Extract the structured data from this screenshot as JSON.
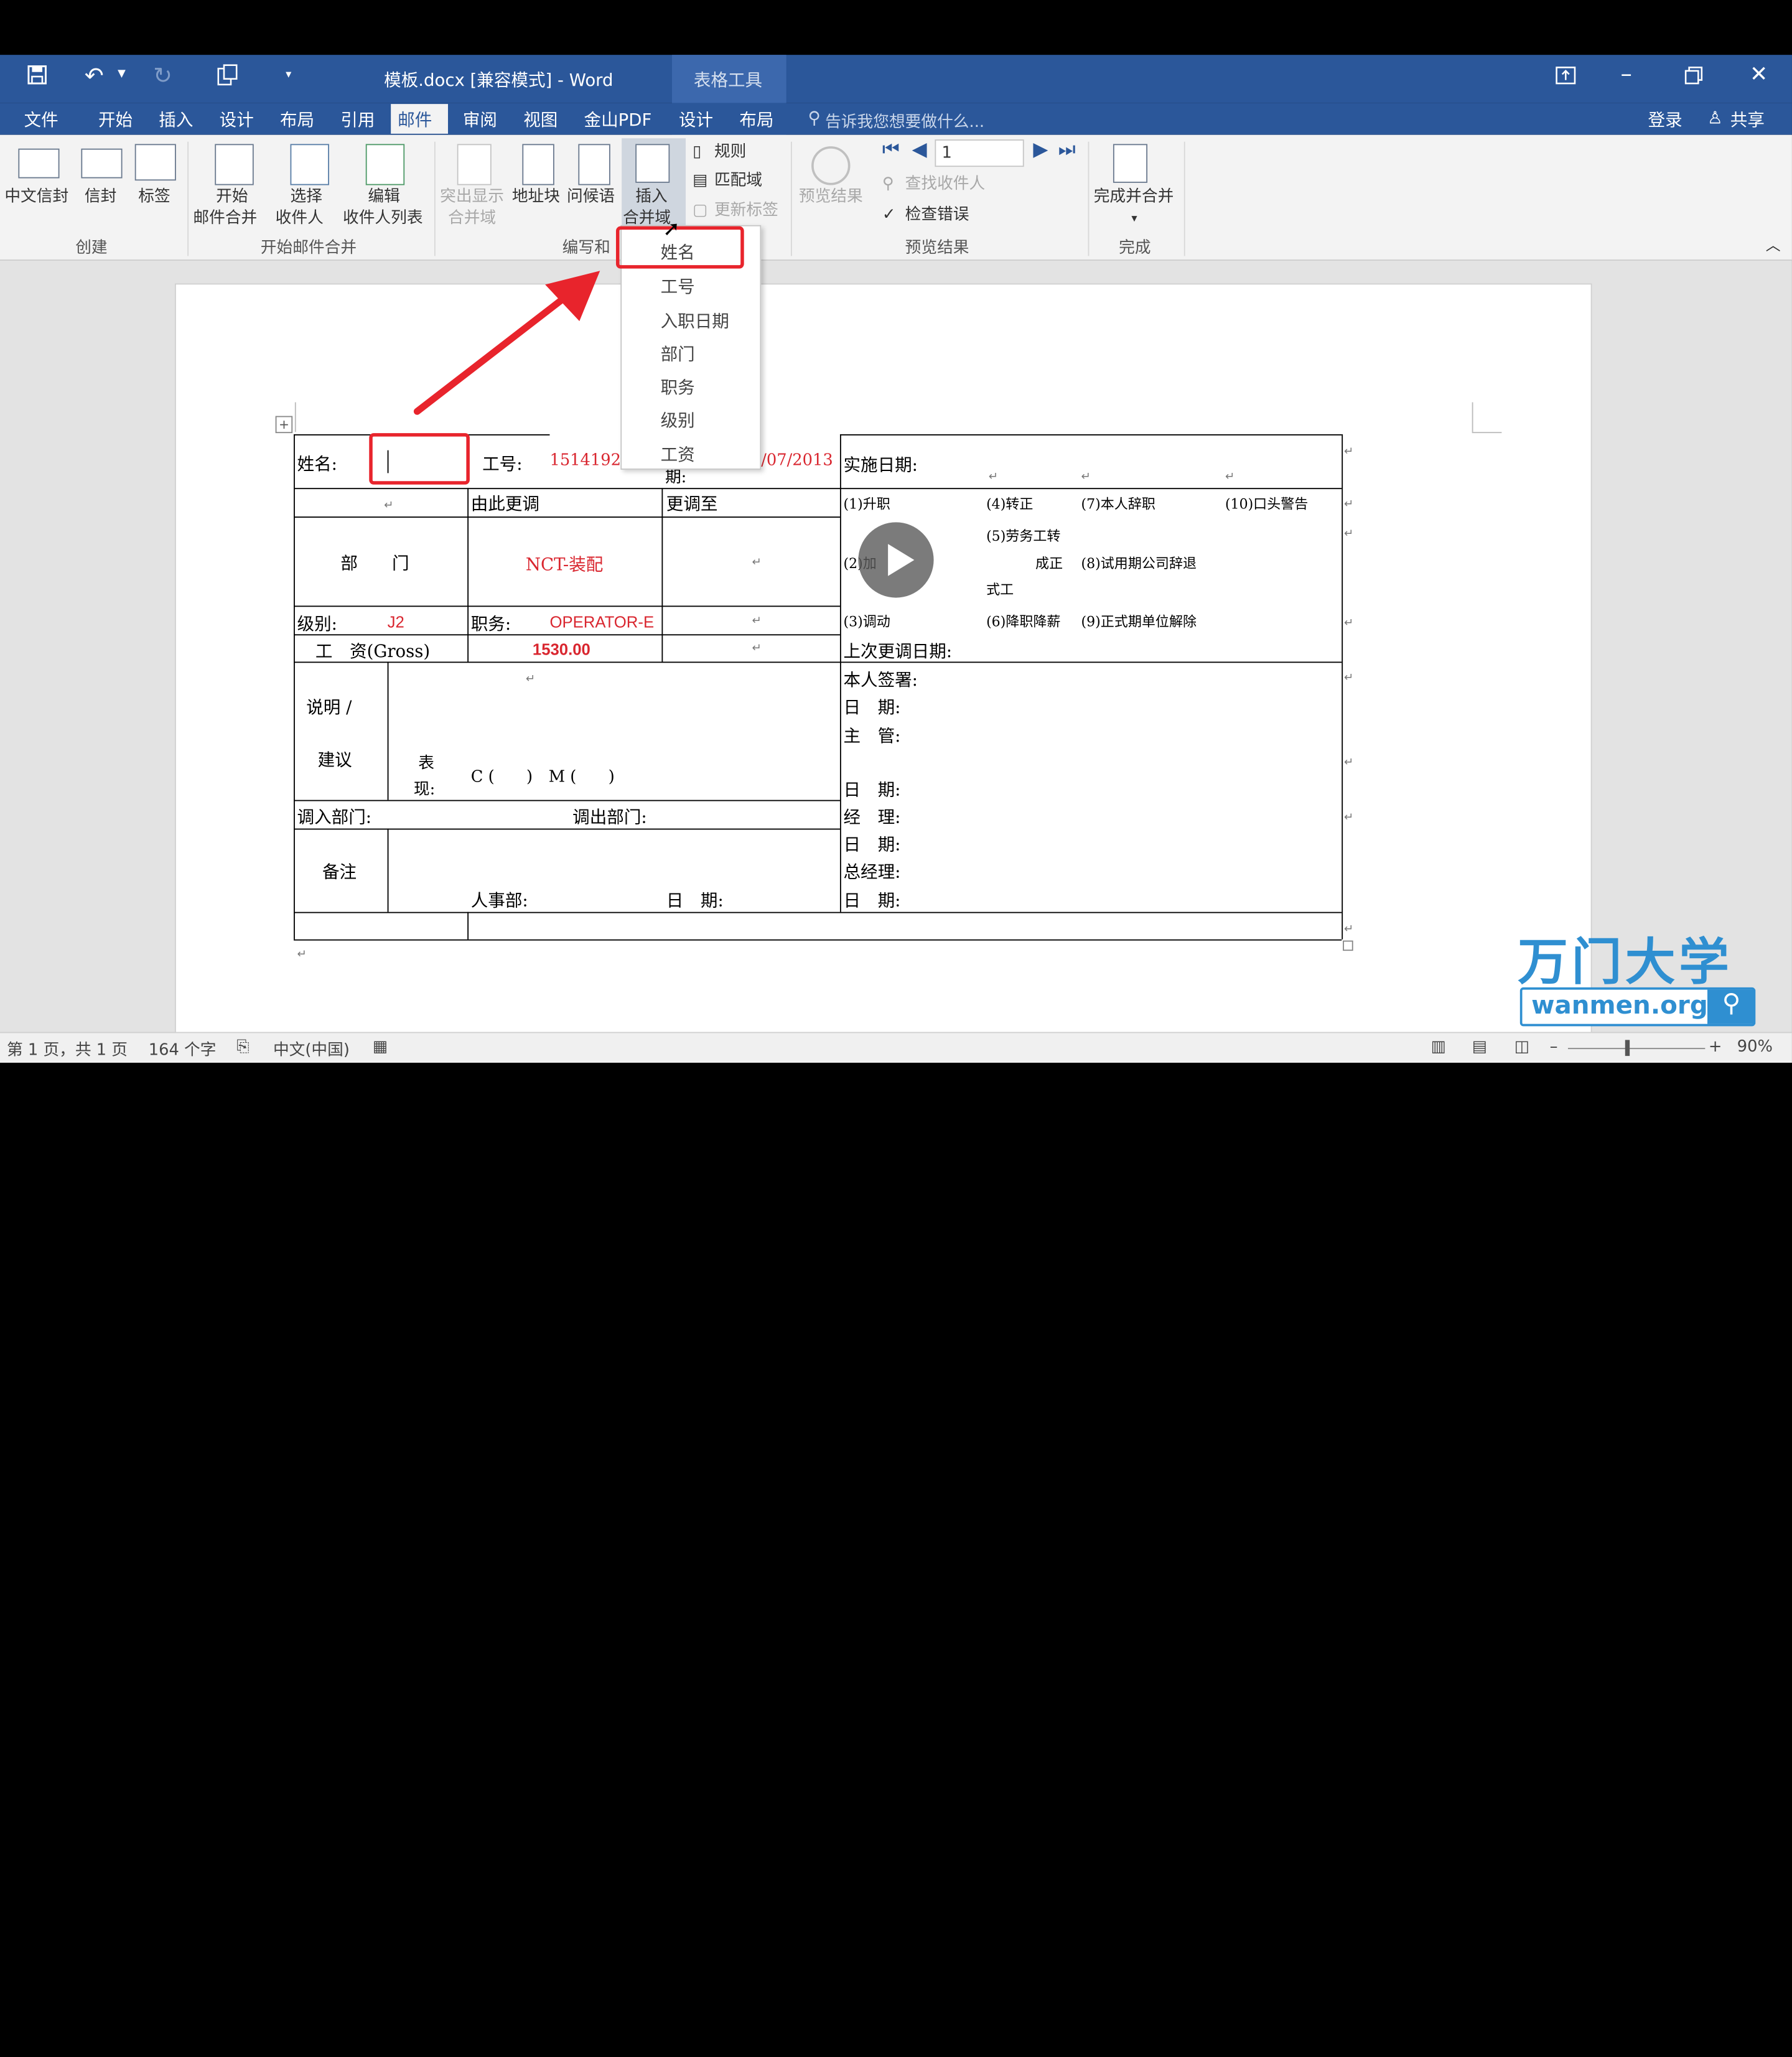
{
  "title": {
    "doc": "模板.docx [兼容模式] - Word",
    "context": "表格工具"
  },
  "tabs": [
    "文件",
    "开始",
    "插入",
    "设计",
    "布局",
    "引用",
    "邮件",
    "审阅",
    "视图",
    "金山PDF",
    "设计",
    "布局"
  ],
  "tell_me": "告诉我您想要做什么...",
  "signin": "登录",
  "share": "共享",
  "ribbon": {
    "create": {
      "cn_env": "中文信封",
      "env": "信封",
      "label": "标签",
      "group": "创建"
    },
    "start": {
      "start1": "开始",
      "start2": "邮件合并",
      "select1": "选择",
      "select2": "收件人",
      "edit1": "编辑",
      "edit2": "收件人列表",
      "group": "开始邮件合并"
    },
    "write": {
      "hl1": "突出显示",
      "hl2": "合并域",
      "addr": "地址块",
      "greet": "问候语",
      "ins1": "插入",
      "ins2": "合并域",
      "rules": "规则",
      "match": "匹配域",
      "update": "更新标签",
      "group": "编写和"
    },
    "preview": {
      "btn": "预览结果",
      "record": "1",
      "find": "查找收件人",
      "check": "检查错误",
      "group": "预览结果"
    },
    "finish": {
      "btn": "完成并合并",
      "group": "完成"
    }
  },
  "menu": [
    "姓名",
    "工号",
    "入职日期",
    "部门",
    "职务",
    "级别",
    "工资"
  ],
  "table": {
    "name_label": "姓名:",
    "id_label": "工号:",
    "id_value": "1514192",
    "date_value": "/07/2013",
    "date_frag": "期:",
    "impl_date": "实施日期:",
    "from": "由此更调",
    "to": "更调至",
    "dept": "部　　门",
    "dept_value": "NCT-装配",
    "level_label": "级别:",
    "level_value": "J2",
    "post_label": "职务:",
    "post_value": "OPERATOR-E",
    "salary_label": "工　资(Gross)",
    "salary_value": "1530.00",
    "opt1": "(1)升职",
    "opt4": "(4)转正",
    "opt7": "(7)本人辞职",
    "opt10": "(10)口头警告",
    "opt5": "(5)劳务工转",
    "opt2": "(2)加",
    "opt5b": "成正",
    "opt8": "(8)试用期公司辞退",
    "opt5c": "式工",
    "opt3": "(3)调动",
    "opt6": "(6)降职降薪",
    "opt9": "(9)正式期单位解除",
    "last_date": "上次更调日期:",
    "remark_label1": "说明 /",
    "remark_label2": "建议",
    "perf1": "表",
    "perf2": "现:",
    "perf_value": "C (　　)　M (　　)",
    "self_sign": "本人签署:",
    "date1": "日　期:",
    "supervisor": "主　管:",
    "date2": "日　期:",
    "in_dept": "调入部门:",
    "out_dept": "调出部门:",
    "manager": "经　理:",
    "date3": "日　期:",
    "note": "备注",
    "gm": "总经理:",
    "hr": "人事部:",
    "date4": "日　期:",
    "date5": "日　期:"
  },
  "status": {
    "page": "第 1 页，共 1 页",
    "words": "164 个字",
    "lang": "中文(中国)",
    "zoom": "90%"
  },
  "watermark": {
    "brand": "万门大学",
    "url": "wanmen.org"
  },
  "colors": {
    "word_blue": "#2b579a",
    "highlight_red": "#e8242c"
  }
}
